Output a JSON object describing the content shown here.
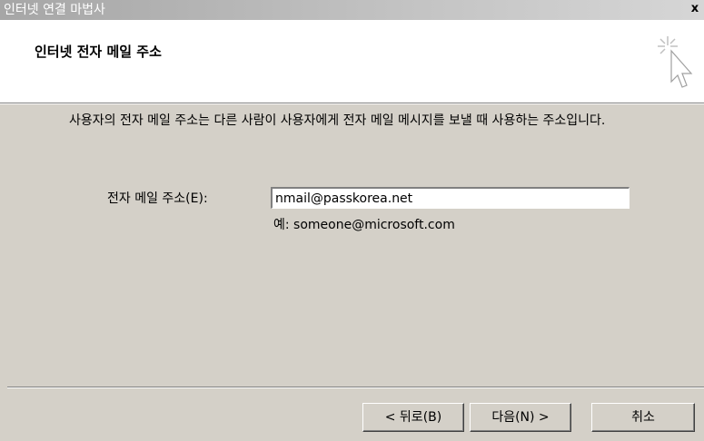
{
  "window": {
    "title": "인터넷 연결 마법사",
    "close_label": "x"
  },
  "header": {
    "title": "인터넷 전자 메일 주소",
    "icon": "wizard-cursor-icon"
  },
  "content": {
    "description": "사용자의 전자 메일 주소는 다른 사람이 사용자에게 전자 메일 메시지를 보낼 때 사용하는 주소입니다.",
    "email_label": "전자 메일 주소(E):",
    "email_value": "nmail@passkorea.net",
    "example": "예: someone@microsoft.com"
  },
  "buttons": {
    "back": "< 뒤로(B)",
    "next": "다음(N) >",
    "cancel": "취소"
  }
}
